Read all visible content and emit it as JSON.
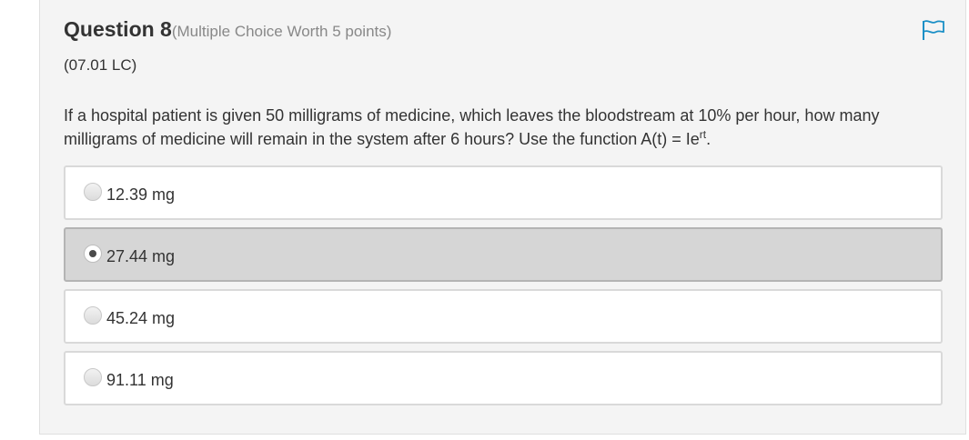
{
  "question": {
    "title": "Question 8",
    "worth": "(Multiple Choice Worth 5 points)",
    "code": "(07.01 LC)",
    "text_main": "If a hospital patient is given 50 milligrams of medicine, which leaves the bloodstream at 10% per hour, how many milligrams of medicine will remain in the system after 6 hours? Use the function A(t) = Ie",
    "text_exponent": "rt",
    "text_end": "."
  },
  "choices": [
    {
      "label": "12.39 mg",
      "selected": false
    },
    {
      "label": "27.44 mg",
      "selected": true
    },
    {
      "label": "45.24 mg",
      "selected": false
    },
    {
      "label": "91.11 mg",
      "selected": false
    }
  ],
  "flag_icon": "flag-icon",
  "colors": {
    "accent": "#1a8fc6",
    "selected_bg": "#d6d6d6",
    "card_bg": "#f4f4f4"
  }
}
